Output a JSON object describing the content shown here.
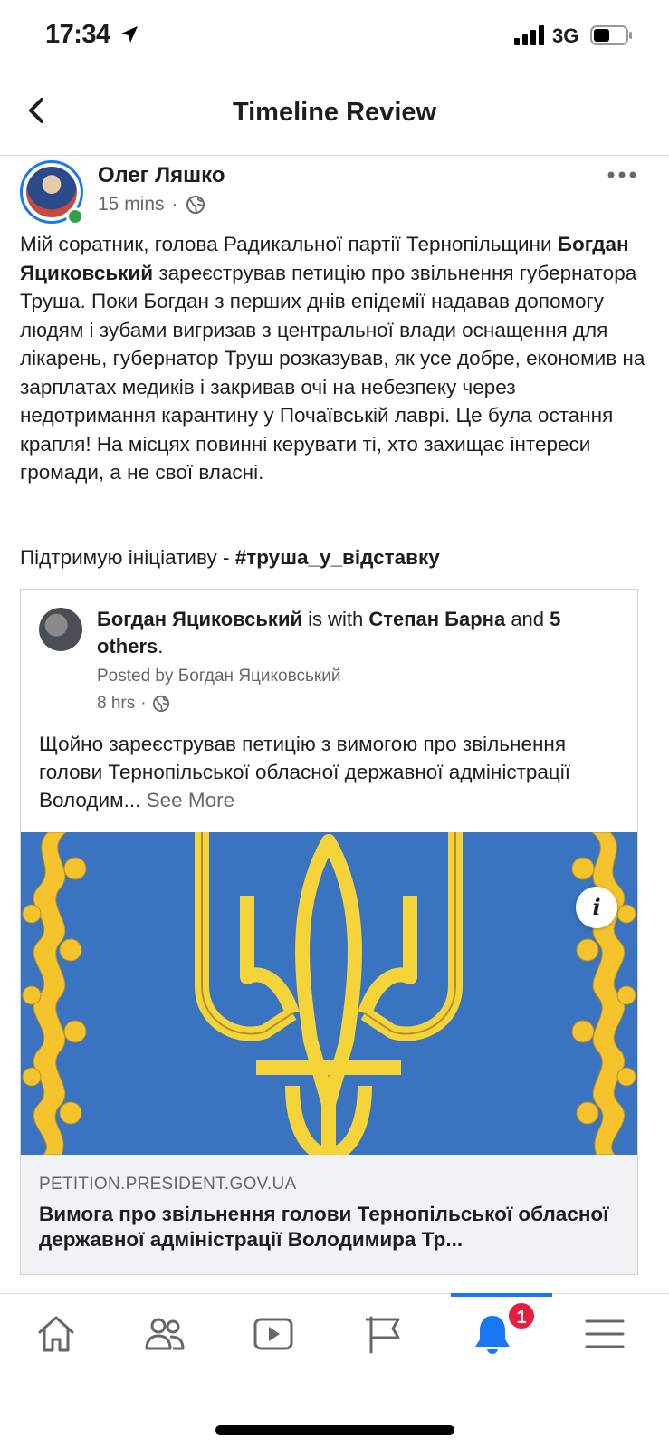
{
  "status_bar": {
    "time": "17:34",
    "network": "3G"
  },
  "header": {
    "title": "Timeline Review"
  },
  "post": {
    "author": "Олег Ляшко",
    "time": "15 mins",
    "separator": "·",
    "text_1": "Мій соратник, голова Радикальної партії Тернопільщини ",
    "text_bold": "Богдан Яциковський",
    "text_2": " зареєстрував петицію про звільнення губернатора Труша. Поки Богдан з перших днів епідемії надавав допомогу людям і зубами вигризав з центральної влади оснащення для лікарень, губернатор Труш розказував, як усе добре, економив на зарплатах медиків і закривав очі на небезпеку через недотримання карантину у Почаївській лаврі. Це була остання крапля! На місцях повинні керувати ті, хто захищає інтереси громади, а не свої власні.",
    "support_text": "Підтримую ініціативу - ",
    "hashtag": "#труша_у_відставку"
  },
  "shared": {
    "author": "Богдан Яциковський",
    "is_with": " is with ",
    "tagged": "Степан Барна",
    "and": " and ",
    "others": "5 others",
    "period": ".",
    "posted_by": "Posted by Богдан Яциковський",
    "time": "8 hrs",
    "separator": "·",
    "text": "Щойно зареєстрував петицію з вимогою про звільнення голови Тернопільської обласної державної адміністрації Володим... ",
    "see_more": "See More",
    "info": "i",
    "link_domain": "PETITION.PRESIDENT.GOV.UA",
    "link_title": "Вимога про звільнення голови Тернопільської обласної державної адміністрації Володимира Тр..."
  },
  "tabbar": {
    "items": [
      "home-icon",
      "friends-icon",
      "watch-icon",
      "pages-flag-icon",
      "notifications-bell-icon",
      "menu-icon"
    ],
    "active": "notifications-bell-icon",
    "notification_count": "1"
  },
  "colors": {
    "accent": "#1877f2",
    "badge": "#e41e3f",
    "flag_blue": "#3a73bf",
    "trident_gold": "#f5d43a"
  }
}
